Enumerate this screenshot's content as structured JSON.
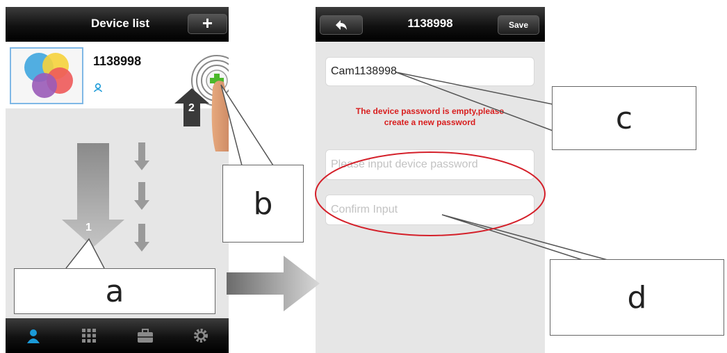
{
  "left_screen": {
    "header": {
      "title": "Device list",
      "add_button": "+"
    },
    "device": {
      "name": "1138998"
    },
    "steps": {
      "step1": "1",
      "step2": "2"
    },
    "tabs": [
      "contacts-icon",
      "grid-icon",
      "toolbox-icon",
      "settings-icon"
    ]
  },
  "right_screen": {
    "header": {
      "back_icon": "back-arrow-icon",
      "title": "1138998",
      "save_label": "Save"
    },
    "device_name_value": "Cam1138998",
    "warning_line1": "The device password is empty,please",
    "warning_line2": "create a new password",
    "password_placeholder": "Please input device password",
    "confirm_placeholder": "Confirm Input"
  },
  "callouts": {
    "a": "a",
    "b": "b",
    "c": "c",
    "d": "d"
  },
  "colors": {
    "accent_blue": "#1b9ad8",
    "warning_red": "#d81e1e",
    "add_green": "#4cb82b",
    "ellipse_red": "#d4202a"
  }
}
